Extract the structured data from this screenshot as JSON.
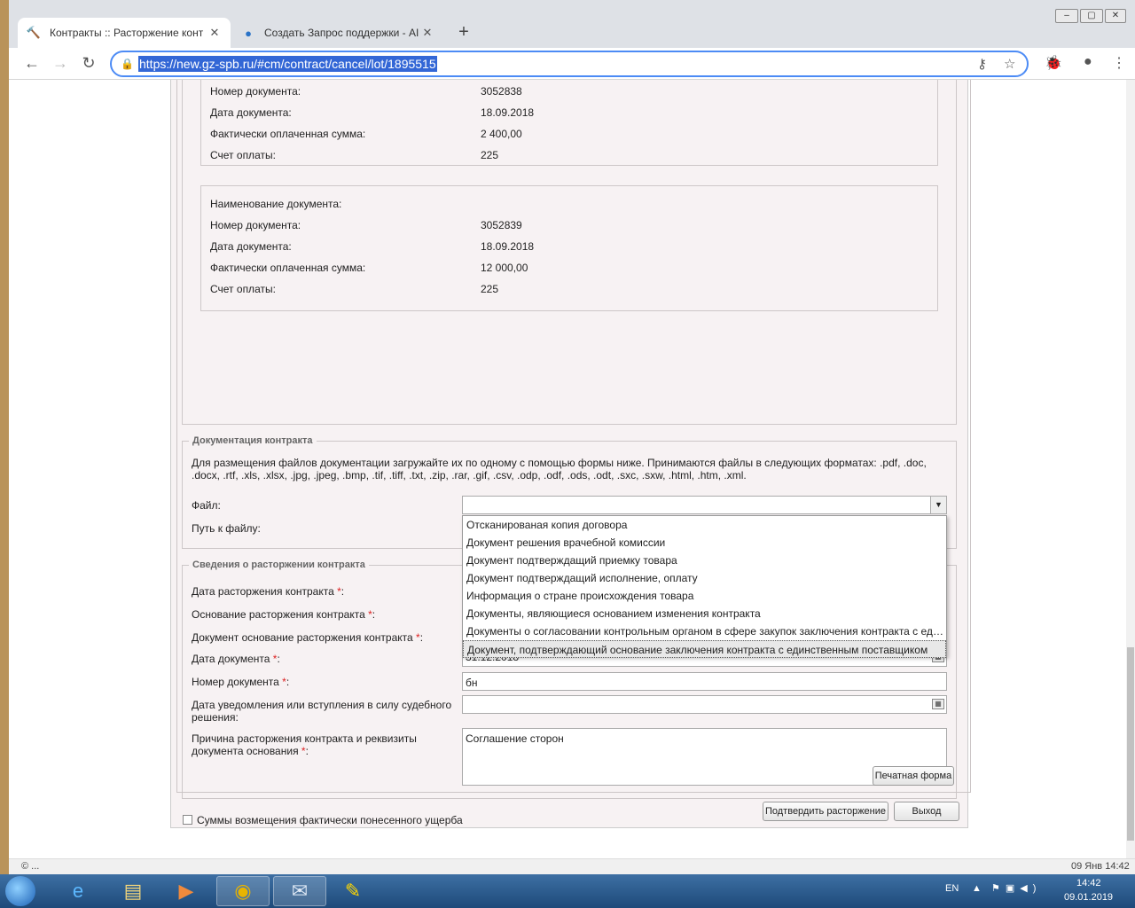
{
  "browser": {
    "tabs": [
      {
        "title": "Контракты :: Расторжение конт",
        "icon": "hammer-icon",
        "active": true
      },
      {
        "title": "Создать Запрос поддержки - AI",
        "icon": "help-icon",
        "active": false
      }
    ],
    "new_tab": "+",
    "url": "https://new.gz-spb.ru/#cm/contract/cancel/lot/1895515"
  },
  "payments": [
    {
      "rows": [
        {
          "label": "Номер документа:",
          "value": "3052838"
        },
        {
          "label": "Дата документа:",
          "value": "18.09.2018"
        },
        {
          "label": "Фактически оплаченная сумма:",
          "value": "2 400,00"
        },
        {
          "label": "Счет оплаты:",
          "value": "225"
        }
      ]
    },
    {
      "name_label": "Наименование документа:",
      "rows": [
        {
          "label": "Номер документа:",
          "value": "3052839"
        },
        {
          "label": "Дата документа:",
          "value": "18.09.2018"
        },
        {
          "label": "Фактически оплаченная сумма:",
          "value": "12 000,00"
        },
        {
          "label": "Счет оплаты:",
          "value": "225"
        }
      ]
    }
  ],
  "docs": {
    "legend": "Документация контракта",
    "info": "Для размещения файлов документации загружайте их по одному с помощью формы ниже. Принимаются файлы в следующих форматах: .pdf, .doc, .docx, .rtf, .xls, .xlsx, .jpg, .jpeg, .bmp, .tif, .tiff, .txt, .zip, .rar, .gif, .csv, .odp, .odf, .ods, .odt, .sxc, .sxw, .html, .htm, .xml.",
    "file_label": "Файл:",
    "path_label": "Путь к файлу:",
    "options": [
      "Отсканированая копия договора",
      "Документ решения врачебной комиссии",
      "Документ подтверждащий приемку товара",
      "Документ подтверждащий исполнение, оплату",
      "Информация о стране происхождения товара",
      "Документы, являющиеся основанием изменения контракта",
      "Документы о согласовании контрольным органом в сфере закупок заключения контракта с единственным поставщиком",
      "Документ, подтверждающий основание заключения контракта с единственным поставщиком"
    ]
  },
  "termination": {
    "legend": "Сведения о расторжении контракта",
    "date_label": "Дата расторжения контракта",
    "basis_label": "Основание расторжения контракта",
    "doc_label": "Документ основание расторжения контракта",
    "doc_date_label": "Дата документа",
    "doc_date_value": "31.12.2018",
    "doc_num_label": "Номер документа",
    "doc_num_value": "бн",
    "notify_label": "Дата уведомления или вступления в силу судебного решения:",
    "notify_value": "",
    "reason_label": "Причина расторжения контракта и реквизиты документа основания",
    "reason_value": "Соглашение сторон",
    "required_mark": "*",
    "colon": ":"
  },
  "damages_checkbox": "Суммы возмещения фактически понесенного ущерба",
  "buttons": {
    "print": "Печатная форма",
    "confirm": "Подтвердить расторжение",
    "exit": "Выход"
  },
  "status_bar": {
    "left": "© ...",
    "right": "09 Янв 14:42"
  },
  "taskbar": {
    "lang": "EN",
    "time": "14:42",
    "date": "09.01.2019"
  }
}
